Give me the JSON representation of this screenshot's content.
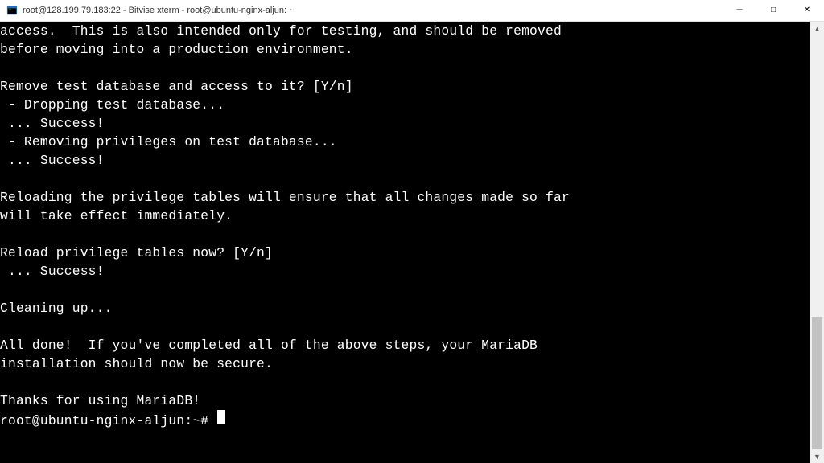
{
  "window": {
    "title": "root@128.199.79.183:22 - Bitvise xterm - root@ubuntu-nginx-aljun: ~"
  },
  "terminal": {
    "lines": [
      "access.  This is also intended only for testing, and should be removed",
      "before moving into a production environment.",
      "",
      "Remove test database and access to it? [Y/n]",
      " - Dropping test database...",
      " ... Success!",
      " - Removing privileges on test database...",
      " ... Success!",
      "",
      "Reloading the privilege tables will ensure that all changes made so far",
      "will take effect immediately.",
      "",
      "Reload privilege tables now? [Y/n]",
      " ... Success!",
      "",
      "Cleaning up...",
      "",
      "All done!  If you've completed all of the above steps, your MariaDB",
      "installation should now be secure.",
      "",
      "Thanks for using MariaDB!"
    ],
    "prompt": "root@ubuntu-nginx-aljun:~# "
  },
  "scrollbar": {
    "thumb_top_pct": 68,
    "thumb_height_pct": 32
  }
}
